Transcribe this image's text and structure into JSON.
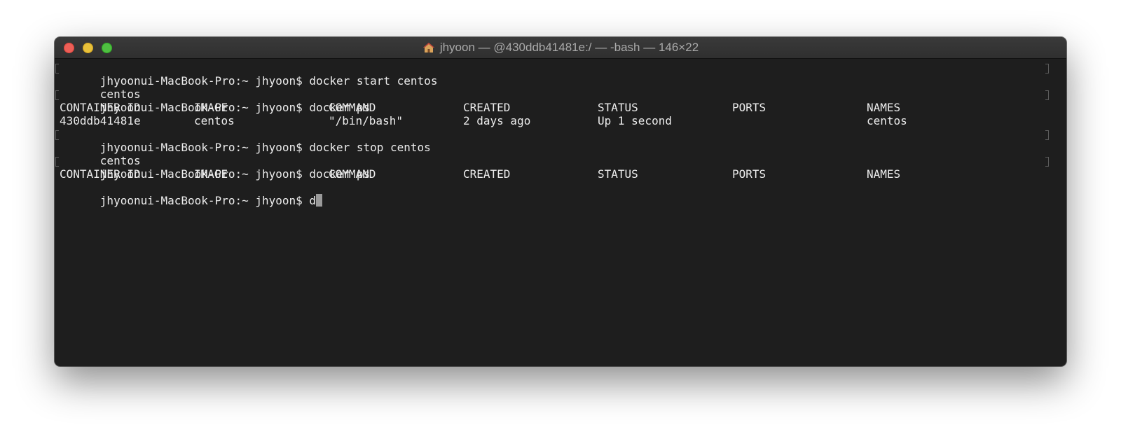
{
  "window": {
    "title": "jhyoon — @430ddb41481e:/ — -bash — 146×22",
    "title_icon": "home-icon"
  },
  "colors": {
    "background": "#1e1e1e",
    "text": "#ececec",
    "titlebar": "#333333",
    "close": "#ed5f57",
    "minimize": "#e8c13a",
    "maximize": "#4fbf41"
  },
  "terminal": {
    "prompt": "jhyoonui-MacBook-Pro:~ jhyoon$ ",
    "commands": [
      "docker start centos",
      "docker ps",
      "docker stop centos",
      "docker ps"
    ],
    "outputs": [
      "centos",
      "centos"
    ],
    "table_headers": [
      "CONTAINER ID",
      "IMAGE",
      "COMMAND",
      "CREATED",
      "STATUS",
      "PORTS",
      "NAMES"
    ],
    "table_row": [
      "430ddb41481e",
      "centos",
      "\"/bin/bash\"",
      "2 days ago",
      "Up 1 second",
      "",
      "centos"
    ],
    "current_input": "d"
  }
}
